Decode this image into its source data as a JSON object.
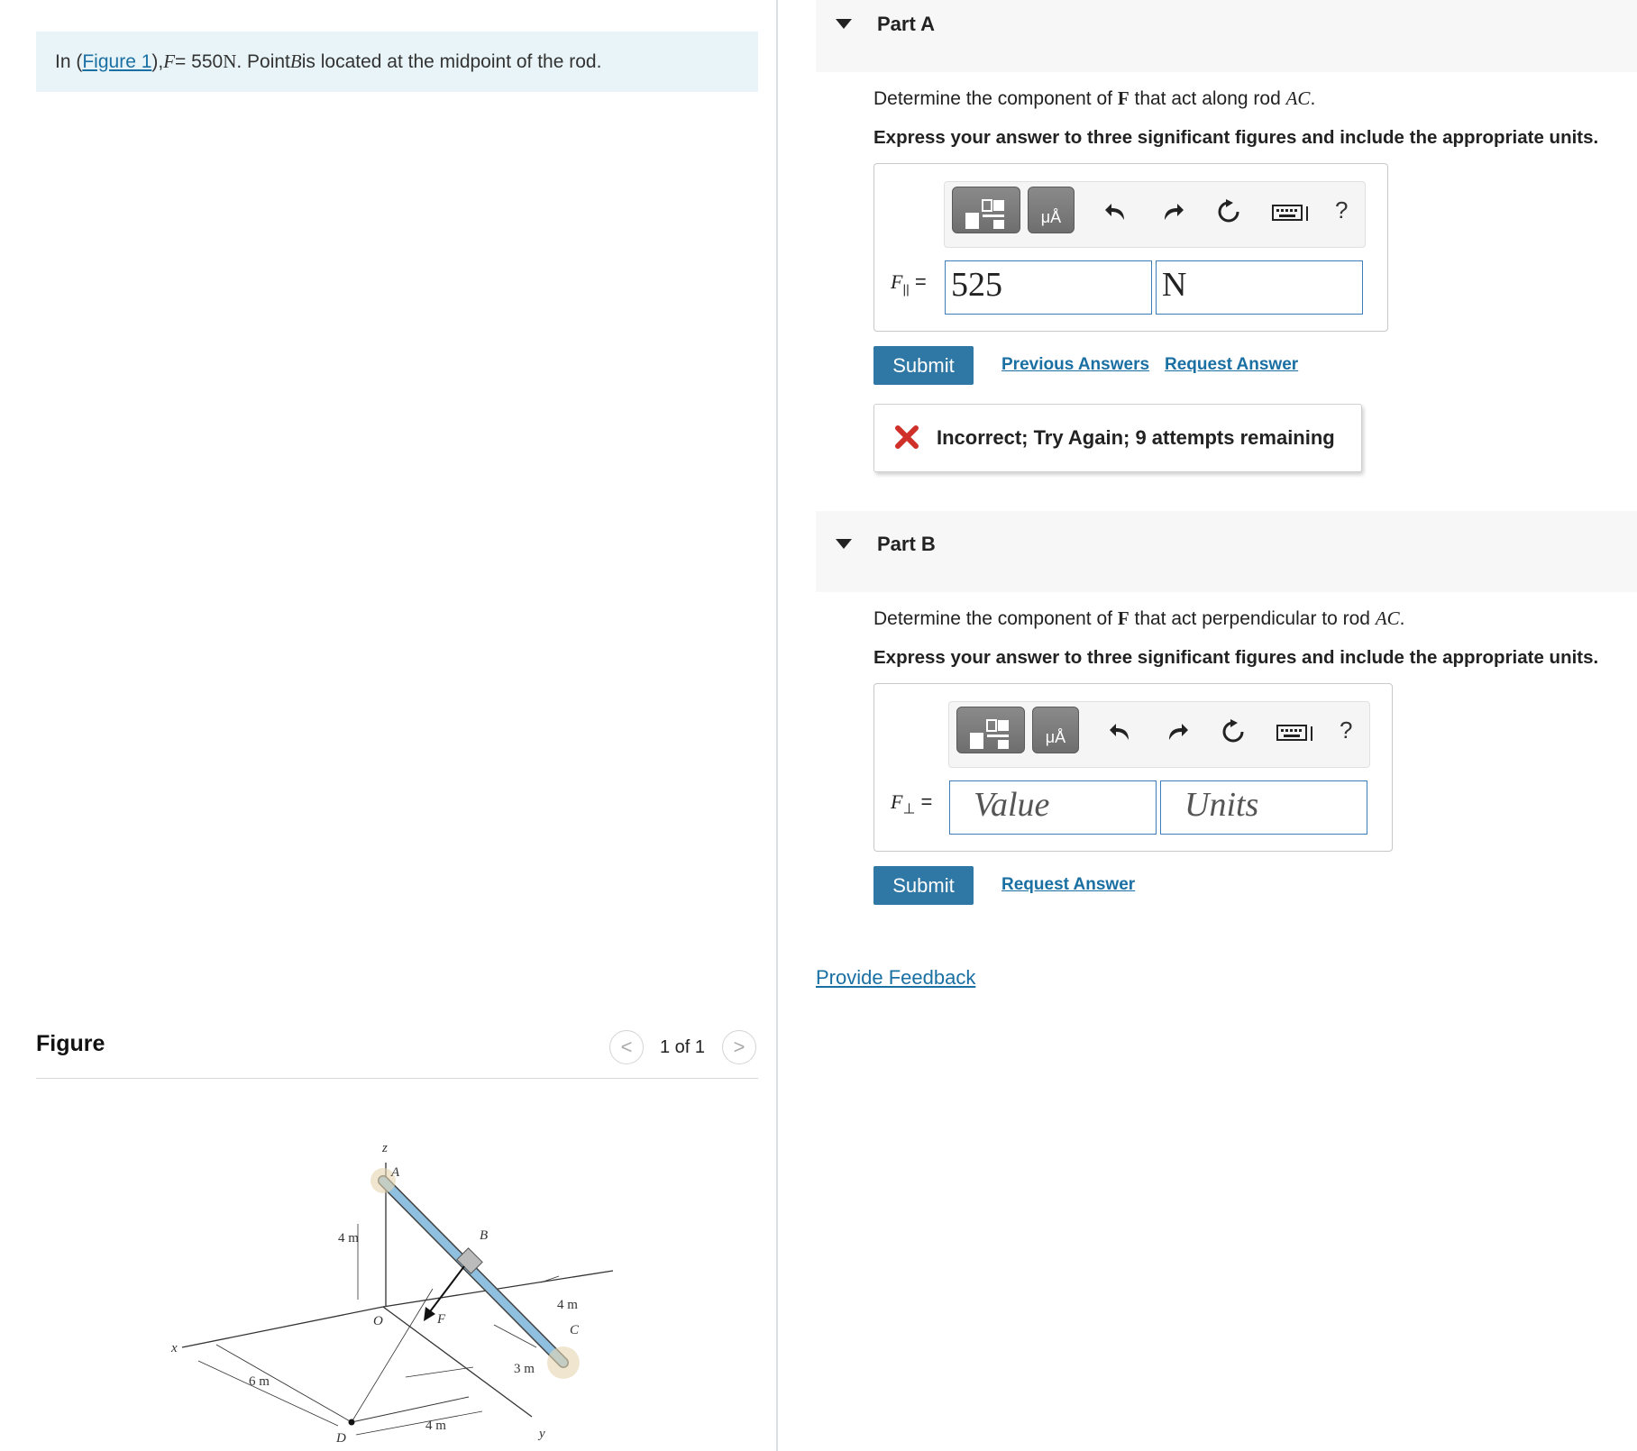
{
  "problem": {
    "prefix": "In (",
    "figure_link": "Figure 1",
    "suffix1": "), ",
    "F_symbol": "F",
    "equals": " = 550 ",
    "unit": "N",
    "suffix2": ". Point ",
    "B_symbol": "B",
    "suffix3": " is located at the midpoint of the rod."
  },
  "figure": {
    "title": "Figure",
    "count": "1 of 1",
    "prev_symbol": "<",
    "next_symbol": ">",
    "labels": {
      "z": "z",
      "A": "A",
      "B": "B",
      "C": "C",
      "D": "D",
      "O": "O",
      "F": "F",
      "x": "x",
      "y": "y",
      "dim_4m_vert": "4 m",
      "dim_4m_right": "4 m",
      "dim_3m": "3 m",
      "dim_6m": "6 m",
      "dim_4m_bottom": "4 m"
    }
  },
  "partA": {
    "title": "Part A",
    "question_prefix": "Determine the component of ",
    "question_F": "F",
    "question_mid": " that act along rod ",
    "question_rod": "AC",
    "question_end": ".",
    "instruction": "Express your answer to three significant figures and include the appropriate units.",
    "var_label": "F",
    "var_sub": "||",
    "var_eq": "=",
    "value": "525",
    "units": "N",
    "submit": "Submit",
    "prev_answers": "Previous Answers",
    "request_answer": "Request Answer",
    "feedback": "Incorrect; Try Again; 9 attempts remaining",
    "help": "?"
  },
  "partB": {
    "title": "Part B",
    "question_prefix": "Determine the component of ",
    "question_F": "F",
    "question_mid": " that act perpendicular to rod ",
    "question_rod": "AC",
    "question_end": ".",
    "instruction": "Express your answer to three significant figures and include the appropriate units.",
    "var_label": "F",
    "var_sub": "⊥",
    "var_eq": "=",
    "value_placeholder": "Value",
    "units_placeholder": "Units",
    "submit": "Submit",
    "request_answer": "Request Answer",
    "help": "?"
  },
  "provide_feedback": "Provide Feedback",
  "colors": {
    "accent": "#2f77a4",
    "link": "#1a6fa3",
    "problem_bg": "#e8f4f7",
    "error_x": "#d0302a",
    "field_border": "#3d7db8",
    "rod": "#8fc0e0"
  }
}
